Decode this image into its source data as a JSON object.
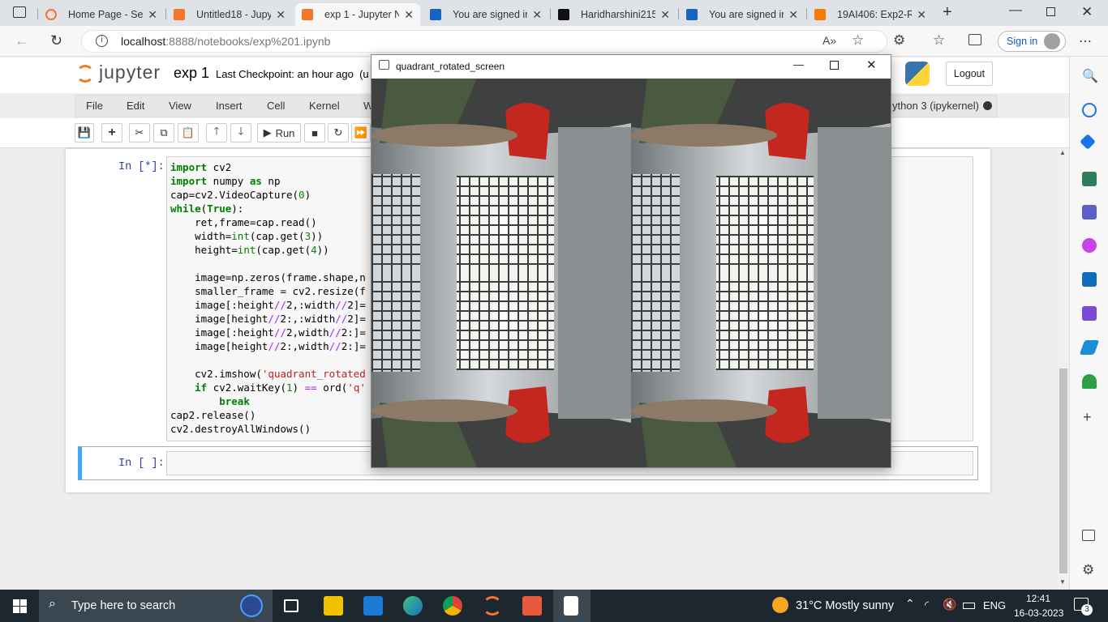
{
  "browser": {
    "tabs": [
      {
        "title": "Home Page - Sele",
        "icon": "jupyter-icon"
      },
      {
        "title": "Untitled18 - Jupy",
        "icon": "notebook-icon"
      },
      {
        "title": "exp 1 - Jupyter N",
        "icon": "hourglass-icon",
        "active": true
      },
      {
        "title": "You are signed in",
        "icon": "s-icon"
      },
      {
        "title": "Haridharshini215",
        "icon": "github-icon"
      },
      {
        "title": "You are signed in",
        "icon": "s-icon"
      },
      {
        "title": "19AI406: Exp2-Re",
        "icon": "moodle-icon"
      }
    ],
    "url_host": "localhost",
    "url_rest": ":8888/notebooks/exp%201.ipynb",
    "sign_in": "Sign in"
  },
  "jupyter": {
    "logo": "jupyter",
    "notebook_name": "exp 1",
    "checkpoint": "Last Checkpoint: an hour ago",
    "checkpoint_suffix": "(u",
    "logout": "Logout",
    "menu": [
      "File",
      "Edit",
      "View",
      "Insert",
      "Cell",
      "Kernel",
      "W"
    ],
    "kernel": "ython 3 (ipykernel)",
    "run_label": "Run",
    "cell1_prompt": "In [*]:",
    "cell2_prompt": "In [ ]:",
    "code_lines": [
      "import cv2",
      "import numpy as np",
      "cap=cv2.VideoCapture(0)",
      "while(True):",
      "    ret,frame=cap.read()",
      "    width=int(cap.get(3))",
      "    height=int(cap.get(4))",
      "",
      "    image=np.zeros(frame.shape,n",
      "    smaller_frame = cv2.resize(f",
      "    image[:height//2,:width//2]=",
      "    image[height//2:,:width//2]=",
      "    image[:height//2,width//2:]=",
      "    image[height//2:,width//2:]=",
      "",
      "    cv2.imshow('quadrant_rotated",
      "    if cv2.waitKey(1) == ord('q'",
      "        break",
      "cap2.release()",
      "cv2.destroyAllWindows()"
    ]
  },
  "cv_window": {
    "title": "quadrant_rotated_screen"
  },
  "taskbar": {
    "search_placeholder": "Type here to search",
    "weather": "31°C  Mostly sunny",
    "lang": "ENG",
    "time": "12:41",
    "date": "16-03-2023",
    "notifications": "3"
  }
}
